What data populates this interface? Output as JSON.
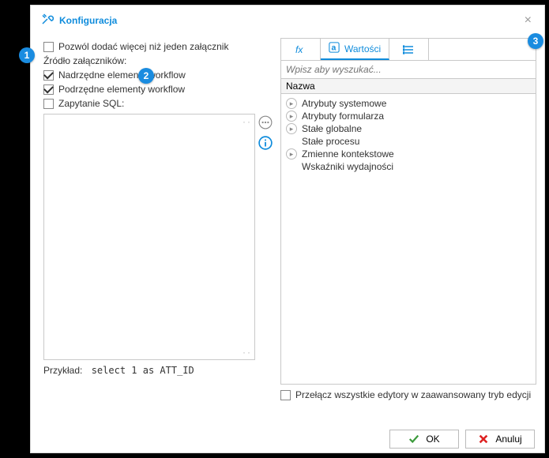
{
  "title": "Konfiguracja",
  "left": {
    "allow_multiple_label": "Pozwól dodać więcej niż jeden załącznik",
    "source_label": "Źródło załączników:",
    "parent_wf_label": "Nadrzędne elementy workflow",
    "child_wf_label": "Podrzędne elementy workflow",
    "sql_query_label": "Zapytanie SQL:",
    "example_label": "Przykład:",
    "example_code": "select 1 as ATT_ID"
  },
  "right": {
    "tab_values_label": "Wartości",
    "search_placeholder": "Wpisz aby wyszukać...",
    "tree_header": "Nazwa",
    "tree_items": [
      "Atrybuty systemowe",
      "Atrybuty formularza",
      "Stałe globalne",
      "Stałe procesu",
      "Zmienne kontekstowe",
      "Wskaźniki wydajności"
    ],
    "advanced_label": "Przełącz wszystkie edytory w zaawansowany tryb edycji"
  },
  "footer": {
    "ok_label": "OK",
    "cancel_label": "Anuluj"
  },
  "callouts": {
    "c1": "1",
    "c2": "2",
    "c3": "3"
  }
}
